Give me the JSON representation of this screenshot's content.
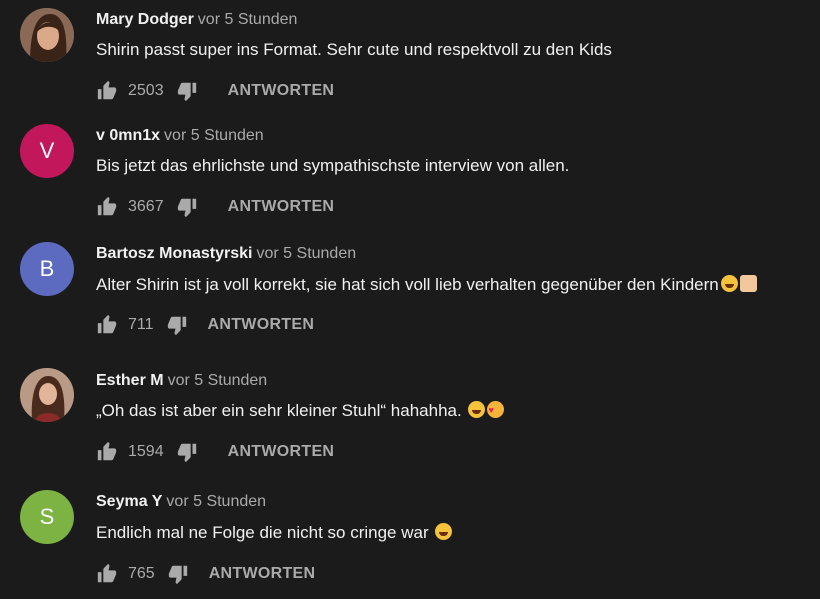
{
  "comments": [
    {
      "author": "Mary Dodger",
      "time": "vor 5 Stunden",
      "text": "Shirin passt super ins Format. Sehr cute und respektvoll zu den Kids",
      "likes": "2503",
      "reply": "ANTWORTEN",
      "avatar_letter": "",
      "avatar_color": "#7a5a4a"
    },
    {
      "author": "v 0mn1x",
      "time": "vor 5 Stunden",
      "text": "Bis jetzt das ehrlichste und sympathischste interview von allen.",
      "likes": "3667",
      "reply": "ANTWORTEN",
      "avatar_letter": "V",
      "avatar_color": "#c2185b"
    },
    {
      "author": "Bartosz Monastyrski",
      "time": "vor 5 Stunden",
      "text": "Alter Shirin ist ja voll korrekt, sie hat sich voll lieb verhalten gegenüber den Kindern",
      "likes": "711",
      "reply": "ANTWORTEN",
      "avatar_letter": "B",
      "avatar_color": "#5c6bc0"
    },
    {
      "author": "Esther M",
      "time": "vor 5 Stunden",
      "text": "„Oh das ist aber ein sehr kleiner Stuhl“ hahahha.",
      "likes": "1594",
      "reply": "ANTWORTEN",
      "avatar_letter": "",
      "avatar_color": "#6d4c3d"
    },
    {
      "author": "Seyma Y",
      "time": "vor 5 Stunden",
      "text": "Endlich mal ne Folge die nicht so cringe war",
      "likes": "765",
      "reply": "ANTWORTEN",
      "avatar_letter": "S",
      "avatar_color": "#7cb342"
    }
  ],
  "icons": {
    "like": "thumbs-up-icon",
    "dislike": "thumbs-down-icon"
  }
}
